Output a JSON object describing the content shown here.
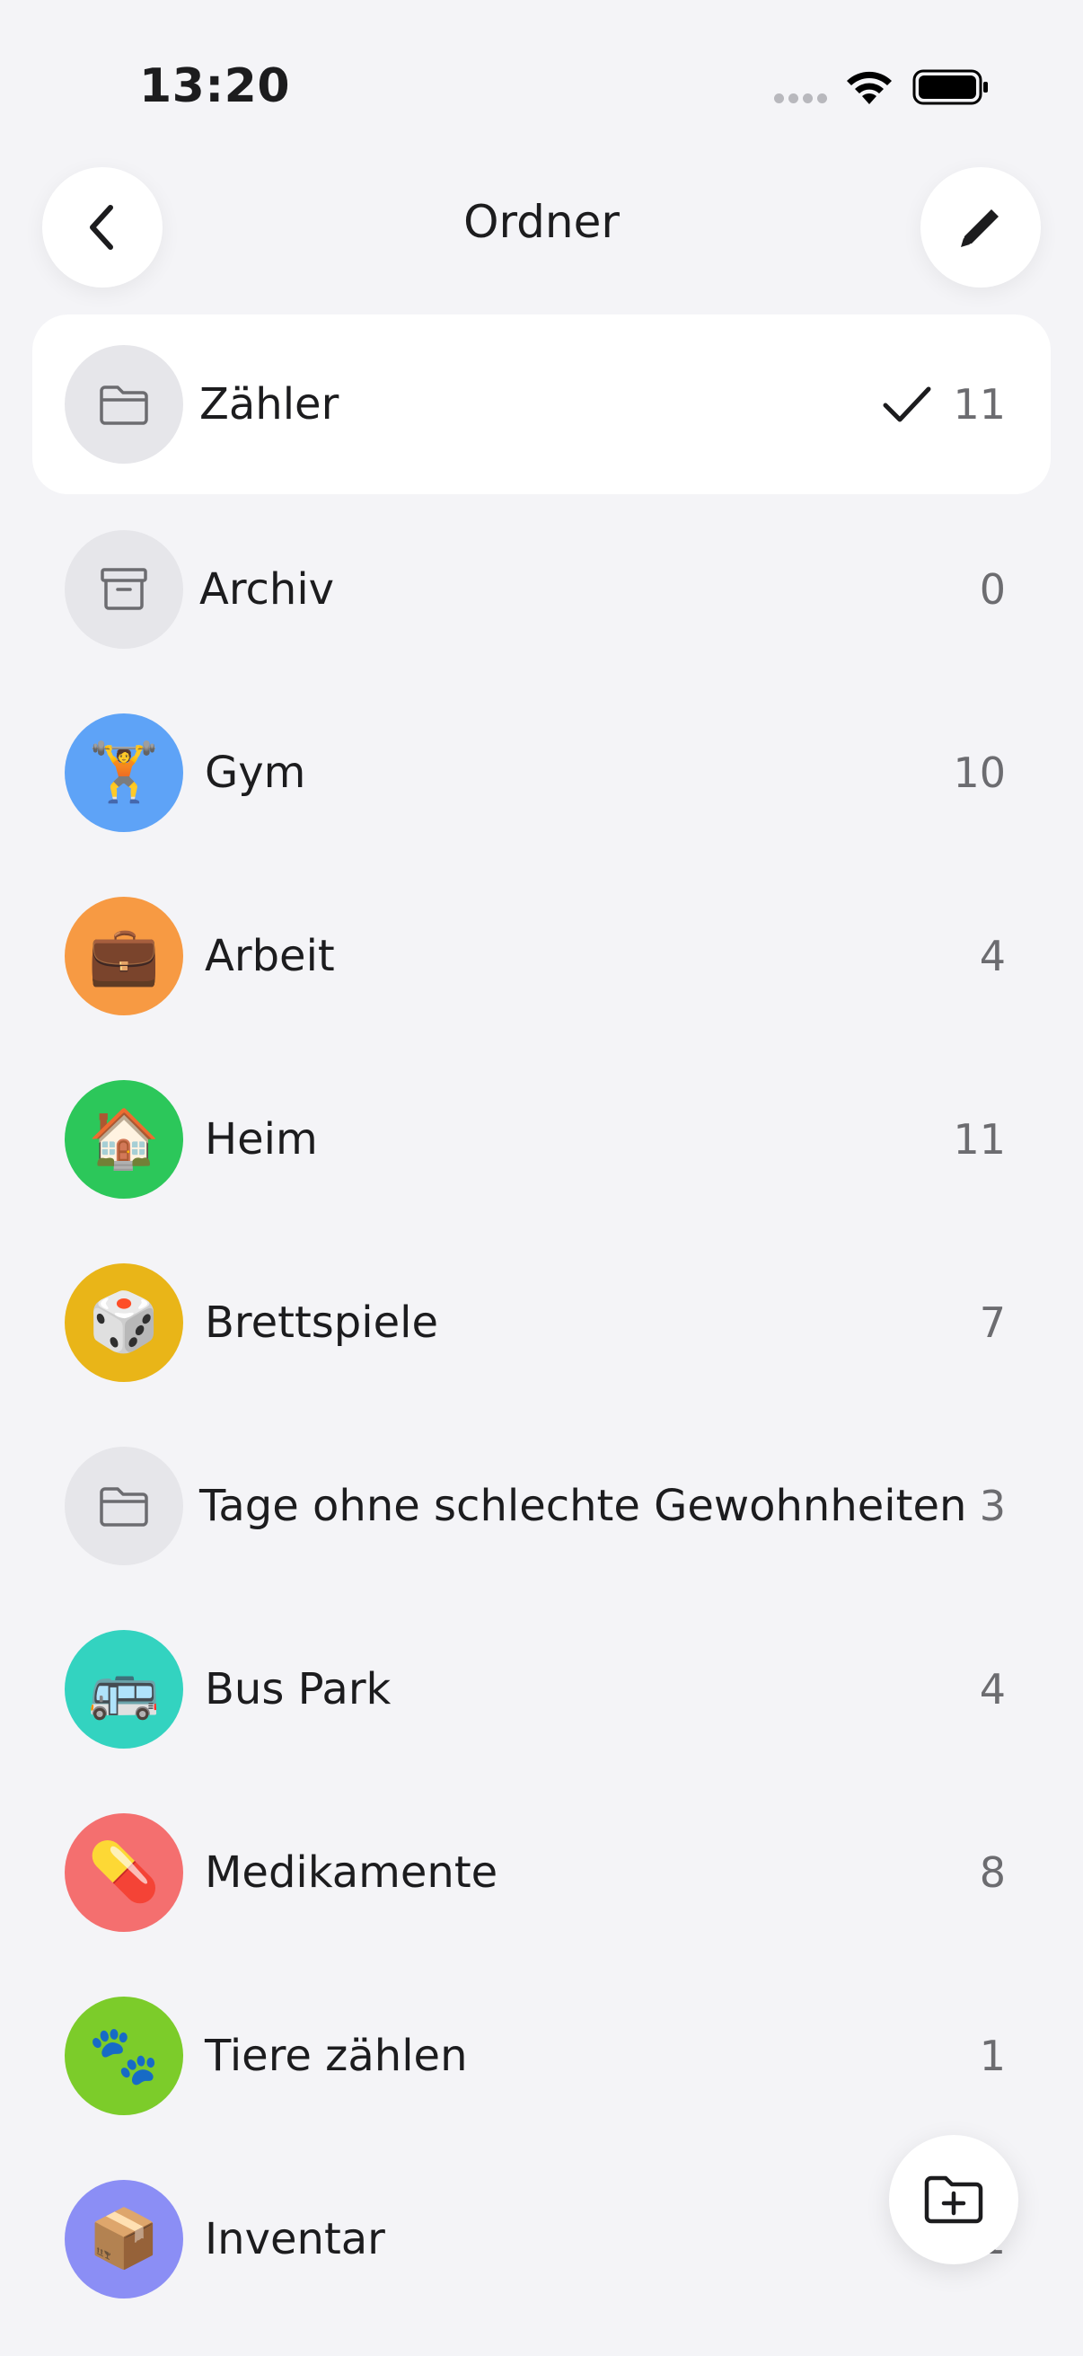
{
  "status_bar": {
    "time": "13:20"
  },
  "header": {
    "title": "Ordner"
  },
  "folders": [
    {
      "name": "Zähler",
      "count": "11",
      "selected": true,
      "icon": "folder-icon",
      "color": "#e6e6ea"
    },
    {
      "name": "Archiv",
      "count": "0",
      "icon": "archive-icon",
      "color": "#e6e6ea"
    },
    {
      "name": "Gym",
      "count": "10",
      "emoji": "🏋️",
      "color": "#5ea3f7"
    },
    {
      "name": "Arbeit",
      "count": "4",
      "emoji": "💼",
      "color": "#f79a43"
    },
    {
      "name": "Heim",
      "count": "11",
      "emoji": "🏠",
      "color": "#2cc75a"
    },
    {
      "name": "Brettspiele",
      "count": "7",
      "emoji": "🎲",
      "color": "#e9b518"
    },
    {
      "name": "Tage ohne schlechte Gewohnheiten",
      "count": "3",
      "icon": "folder-icon",
      "color": "#e6e6ea"
    },
    {
      "name": "Bus Park",
      "count": "4",
      "emoji": "🚌",
      "color": "#33d3c0"
    },
    {
      "name": "Medikamente",
      "count": "8",
      "emoji": "💊",
      "color": "#f46f6f"
    },
    {
      "name": "Tiere zählen",
      "count": "1",
      "emoji": "🐾",
      "color": "#7ccc2a"
    },
    {
      "name": "Inventar",
      "count": "1",
      "emoji": "📦",
      "color": "#8b8ef5"
    }
  ],
  "colors": {
    "background": "#f4f4f7",
    "accent": "#1c1c1e"
  }
}
